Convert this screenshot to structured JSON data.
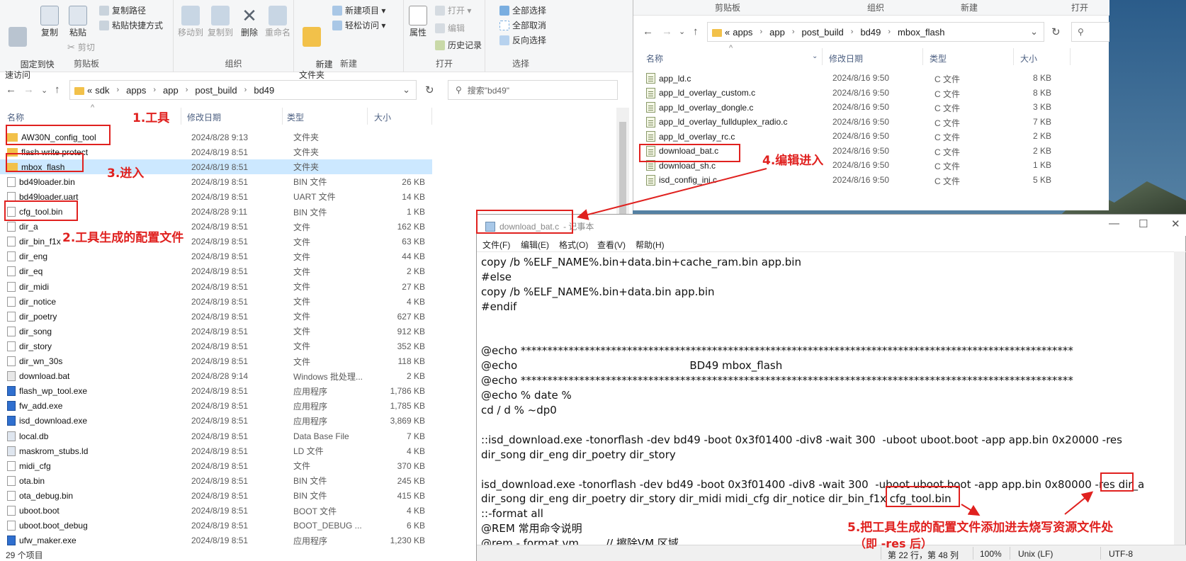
{
  "left_explorer": {
    "ribbon": {
      "clipboard": {
        "pin_label": "固定到快\n速访问",
        "copy_label": "复制",
        "paste_label": "粘贴",
        "copy_path": "复制路径",
        "paste_shortcut": "粘贴快捷方式",
        "cut": "剪切",
        "group_label": "剪贴板"
      },
      "organize": {
        "move_to": "移动到",
        "copy_to": "复制到",
        "delete": "删除",
        "rename": "重命名",
        "group_label": "组织"
      },
      "new": {
        "new_folder": "新建\n文件夹",
        "new_item": "新建项目 ▾",
        "easy_access": "轻松访问 ▾",
        "group_label": "新建"
      },
      "open": {
        "properties": "属性",
        "open": "打开 ▾",
        "edit": "编辑",
        "history": "历史记录",
        "group_label": "打开"
      },
      "select": {
        "select_all": "全部选择",
        "select_none": "全部取消",
        "invert": "反向选择",
        "group_label": "选择"
      }
    },
    "address": {
      "crumbs": [
        "«",
        "sdk",
        "apps",
        "app",
        "post_build",
        "bd49"
      ],
      "search_placeholder": "搜索\"bd49\""
    },
    "columns": {
      "name": "名称",
      "date": "修改日期",
      "type": "类型",
      "size": "大小"
    },
    "files": [
      {
        "name": "AW30N_config_tool",
        "date": "2024/8/28 9:13",
        "type": "文件夹",
        "size": "",
        "icon": "folder"
      },
      {
        "name": "flash write protect",
        "date": "2024/8/19 8:51",
        "type": "文件夹",
        "size": "",
        "icon": "folder"
      },
      {
        "name": "mbox_flash",
        "date": "2024/8/19 8:51",
        "type": "文件夹",
        "size": "",
        "icon": "folder"
      },
      {
        "name": "bd49loader.bin",
        "date": "2024/8/19 8:51",
        "type": "BIN 文件",
        "size": "26 KB",
        "icon": "file"
      },
      {
        "name": "bd49loader.uart",
        "date": "2024/8/19 8:51",
        "type": "UART 文件",
        "size": "14 KB",
        "icon": "file"
      },
      {
        "name": "cfg_tool.bin",
        "date": "2024/8/28 9:11",
        "type": "BIN 文件",
        "size": "1 KB",
        "icon": "file"
      },
      {
        "name": "dir_a",
        "date": "2024/8/19 8:51",
        "type": "文件",
        "size": "162 KB",
        "icon": "file"
      },
      {
        "name": "dir_bin_f1x",
        "date": "2024/8/19 8:51",
        "type": "文件",
        "size": "63 KB",
        "icon": "file"
      },
      {
        "name": "dir_eng",
        "date": "2024/8/19 8:51",
        "type": "文件",
        "size": "44 KB",
        "icon": "file"
      },
      {
        "name": "dir_eq",
        "date": "2024/8/19 8:51",
        "type": "文件",
        "size": "2 KB",
        "icon": "file"
      },
      {
        "name": "dir_midi",
        "date": "2024/8/19 8:51",
        "type": "文件",
        "size": "27 KB",
        "icon": "file"
      },
      {
        "name": "dir_notice",
        "date": "2024/8/19 8:51",
        "type": "文件",
        "size": "4 KB",
        "icon": "file"
      },
      {
        "name": "dir_poetry",
        "date": "2024/8/19 8:51",
        "type": "文件",
        "size": "627 KB",
        "icon": "file"
      },
      {
        "name": "dir_song",
        "date": "2024/8/19 8:51",
        "type": "文件",
        "size": "912 KB",
        "icon": "file"
      },
      {
        "name": "dir_story",
        "date": "2024/8/19 8:51",
        "type": "文件",
        "size": "352 KB",
        "icon": "file"
      },
      {
        "name": "dir_wn_30s",
        "date": "2024/8/19 8:51",
        "type": "文件",
        "size": "118 KB",
        "icon": "file"
      },
      {
        "name": "download.bat",
        "date": "2024/8/28 9:14",
        "type": "Windows 批处理...",
        "size": "2 KB",
        "icon": "bat"
      },
      {
        "name": "flash_wp_tool.exe",
        "date": "2024/8/19 8:51",
        "type": "应用程序",
        "size": "1,786 KB",
        "icon": "exe"
      },
      {
        "name": "fw_add.exe",
        "date": "2024/8/19 8:51",
        "type": "应用程序",
        "size": "1,785 KB",
        "icon": "exe"
      },
      {
        "name": "isd_download.exe",
        "date": "2024/8/19 8:51",
        "type": "应用程序",
        "size": "3,869 KB",
        "icon": "exe"
      },
      {
        "name": "local.db",
        "date": "2024/8/19 8:51",
        "type": "Data Base File",
        "size": "7 KB",
        "icon": "db"
      },
      {
        "name": "maskrom_stubs.ld",
        "date": "2024/8/19 8:51",
        "type": "LD 文件",
        "size": "4 KB",
        "icon": "db"
      },
      {
        "name": "midi_cfg",
        "date": "2024/8/19 8:51",
        "type": "文件",
        "size": "370 KB",
        "icon": "file"
      },
      {
        "name": "ota.bin",
        "date": "2024/8/19 8:51",
        "type": "BIN 文件",
        "size": "245 KB",
        "icon": "file"
      },
      {
        "name": "ota_debug.bin",
        "date": "2024/8/19 8:51",
        "type": "BIN 文件",
        "size": "415 KB",
        "icon": "file"
      },
      {
        "name": "uboot.boot",
        "date": "2024/8/19 8:51",
        "type": "BOOT 文件",
        "size": "4 KB",
        "icon": "file"
      },
      {
        "name": "uboot.boot_debug",
        "date": "2024/8/19 8:51",
        "type": "BOOT_DEBUG ...",
        "size": "6 KB",
        "icon": "file"
      },
      {
        "name": "ufw_maker.exe",
        "date": "2024/8/19 8:51",
        "type": "应用程序",
        "size": "1,230 KB",
        "icon": "exe"
      }
    ],
    "status": "29 个项目"
  },
  "right_explorer": {
    "top_strip": [
      "剪贴板",
      "组织",
      "新建",
      "打开"
    ],
    "address": {
      "crumbs": [
        "«",
        "apps",
        "app",
        "post_build",
        "bd49",
        "mbox_flash"
      ]
    },
    "columns": {
      "name": "名称",
      "date": "修改日期",
      "type": "类型",
      "size": "大小"
    },
    "files": [
      {
        "name": "app_ld.c",
        "date": "2024/8/16 9:50",
        "type": "C 文件",
        "size": "8 KB"
      },
      {
        "name": "app_ld_overlay_custom.c",
        "date": "2024/8/16 9:50",
        "type": "C 文件",
        "size": "8 KB"
      },
      {
        "name": "app_ld_overlay_dongle.c",
        "date": "2024/8/16 9:50",
        "type": "C 文件",
        "size": "3 KB"
      },
      {
        "name": "app_ld_overlay_fullduplex_radio.c",
        "date": "2024/8/16 9:50",
        "type": "C 文件",
        "size": "7 KB"
      },
      {
        "name": "app_ld_overlay_rc.c",
        "date": "2024/8/16 9:50",
        "type": "C 文件",
        "size": "2 KB"
      },
      {
        "name": "download_bat.c",
        "date": "2024/8/16 9:50",
        "type": "C 文件",
        "size": "2 KB"
      },
      {
        "name": "download_sh.c",
        "date": "2024/8/16 9:50",
        "type": "C 文件",
        "size": "1 KB"
      },
      {
        "name": "isd_config_ini.c",
        "date": "2024/8/16 9:50",
        "type": "C 文件",
        "size": "5 KB"
      }
    ]
  },
  "notepad": {
    "title_file": "download_bat.c",
    "title_suffix": " - 记事本",
    "menu": [
      "文件(F)",
      "编辑(E)",
      "格式(O)",
      "查看(V)",
      "帮助(H)"
    ],
    "lines": [
      "copy /b %ELF_NAME%.bin+data.bin+cache_ram.bin app.bin",
      "#else",
      "copy /b %ELF_NAME%.bin+data.bin app.bin",
      "#endif",
      "",
      "",
      "@echo ********************************************************************************************************",
      "@echo                                                   BD49 mbox_flash",
      "@echo ********************************************************************************************************",
      "@echo % date %",
      "cd / d % ~dp0",
      "",
      "::isd_download.exe -tonorflash -dev bd49 -boot 0x3f01400 -div8 -wait 300  -uboot uboot.boot -app app.bin 0x20000 -res",
      "dir_song dir_eng dir_poetry dir_story",
      "",
      "isd_download.exe -tonorflash -dev bd49 -boot 0x3f01400 -div8 -wait 300  -uboot uboot.boot -app app.bin 0x80000 -res dir_a",
      "dir_song dir_eng dir_poetry dir_story dir_midi midi_cfg dir_notice dir_bin_f1x cfg_tool.bin",
      "::-format all",
      "@REM 常用命令说明",
      "@rem - format vm        // 擦除VM 区域"
    ],
    "status": {
      "position": "第 22 行，第 48 列",
      "zoom": "100%",
      "eol": "Unix (LF)",
      "encoding": "UTF-8"
    }
  },
  "annotations": {
    "step1": "1.工具",
    "step2": "2.工具生成的配置文件",
    "step3": "3.进入",
    "step4": "4.编辑进入",
    "step5_line1": "5.把工具生成的配置文件添加进去烧写资源文件处",
    "step5_line2": "（即 -res 后）",
    "color": "#e0211f"
  }
}
